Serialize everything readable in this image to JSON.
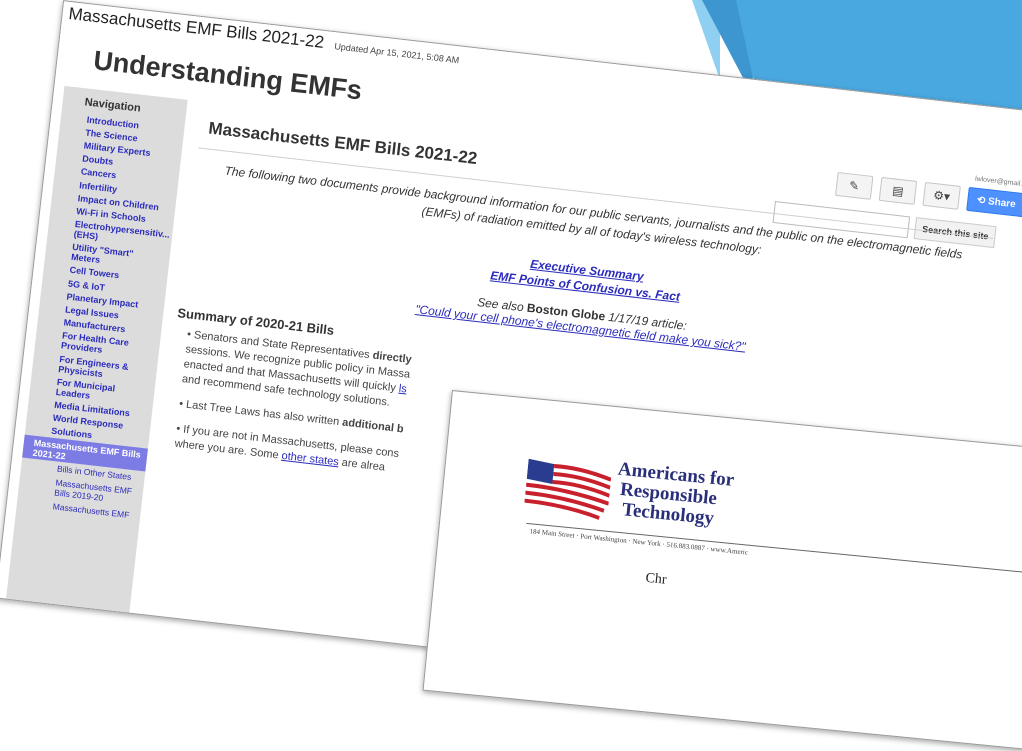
{
  "browser": {
    "breadcrumb": "Massachusetts EMF Bills 2021-22",
    "updated": "Updated Apr 15, 2021, 5:08 AM"
  },
  "site": {
    "title": "Understanding EMFs",
    "user": "lwlover@gmail.com"
  },
  "nav": {
    "heading": "Navigation",
    "items": [
      "Introduction",
      "The Science",
      "Military Experts",
      "Doubts",
      "Cancers",
      "Infertility",
      "Impact on Children",
      "Wi-Fi in Schools",
      "Electrohypersensitiv... (EHS)",
      "Utility \"Smart\" Meters",
      "Cell Towers",
      "5G & IoT",
      "Planetary Impact",
      "Legal Issues",
      "Manufacturers",
      "For Health Care Providers",
      "For Engineers & Physicists",
      "For Municipal Leaders",
      "Media Limitations",
      "World Response",
      "Solutions"
    ],
    "active": "Massachusetts EMF Bills 2021-22",
    "subitems": [
      "Bills in Other States",
      "Massachusetts EMF Bills 2019-20",
      "Massachusetts EMF"
    ]
  },
  "toolbar": {
    "edit_icon": "pencil-icon",
    "page_icon": "page-icon",
    "settings_icon": "gear-icon",
    "share_label": "Share"
  },
  "search": {
    "button": "Search this site",
    "placeholder": ""
  },
  "main": {
    "title": "Massachusetts EMF Bills 2021-22",
    "intro": "The following two documents provide background information for our public servants, journalists and the public on the electromagnetic fields (EMFs) of radiation emitted by all of today's wireless technology:",
    "links": [
      "Executive Summary",
      "EMF Points of Confusion vs. Fact"
    ],
    "see_also_prefix": "See also",
    "see_also_source": "Boston Globe",
    "see_also_suffix": "1/17/19 article:",
    "article_link": "\"Could your cell phone's electromagnetic field make you sick?\"",
    "summary_title": "Summary of 2020-21 Bills",
    "bullet1_a": "Senators and State Representatives",
    "bullet1_b": "directly",
    "bullet1_c": "sessions. We recognize public policy in Massa",
    "bullet1_d": "enacted and that Massachusetts will quickly",
    "bullet1_link": "ls",
    "bullet1_e": "and recommend safe technology solutions.",
    "bullet2_a": "Last Tree Laws has also written",
    "bullet2_b": "additional b",
    "bullet3_a": "If you are not in Massachusetts, please cons",
    "bullet3_b": "where you are. Some",
    "bullet3_link": "other states",
    "bullet3_c": "are alrea"
  },
  "letter": {
    "org_line1": "Americans for",
    "org_line2": "Responsible",
    "org_line3": "Technology",
    "address": "184 Main Street · Port Washington · New York · 516.883.0887 · www.Americ",
    "partial_text": "Chr"
  },
  "colors": {
    "deco_blue": "#4aa8e0",
    "deco_light": "#8fd0f2",
    "link": "#2b2bbd",
    "nav_active": "#7c7ce4",
    "share": "#4d90fe"
  }
}
